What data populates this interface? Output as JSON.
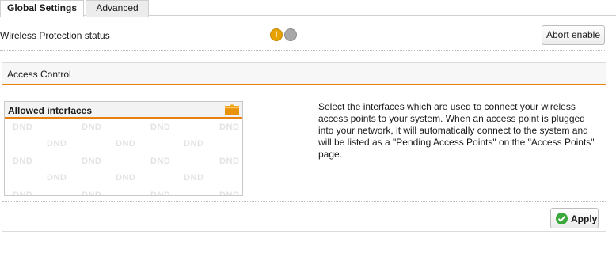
{
  "tabs": [
    {
      "label": "Global Settings",
      "active": true
    },
    {
      "label": "Advanced",
      "active": false
    }
  ],
  "wireless_protection": {
    "label": "Wireless Protection status",
    "indicators": [
      {
        "icon": "warning-icon",
        "symbol": "!",
        "color": "#e8a200"
      },
      {
        "icon": "status-off-icon",
        "symbol": "",
        "color": "#a8a8a8"
      }
    ],
    "abort_label": "Abort enable"
  },
  "access_control": {
    "title": "Access Control",
    "accent_color": "#e8820f",
    "allowed_interfaces": {
      "title": "Allowed interfaces",
      "folder_icon": "folder-icon",
      "placeholder_watermark": "DND"
    },
    "help_text": "Select the interfaces which are used to connect your wireless access points to your system. When an access point is plugged into your network, it will automatically connect to the system and will be listed as a \"Pending Access Points\" on the \"Access Points\" page.",
    "apply_label": "Apply",
    "apply_icon": "check-icon"
  }
}
